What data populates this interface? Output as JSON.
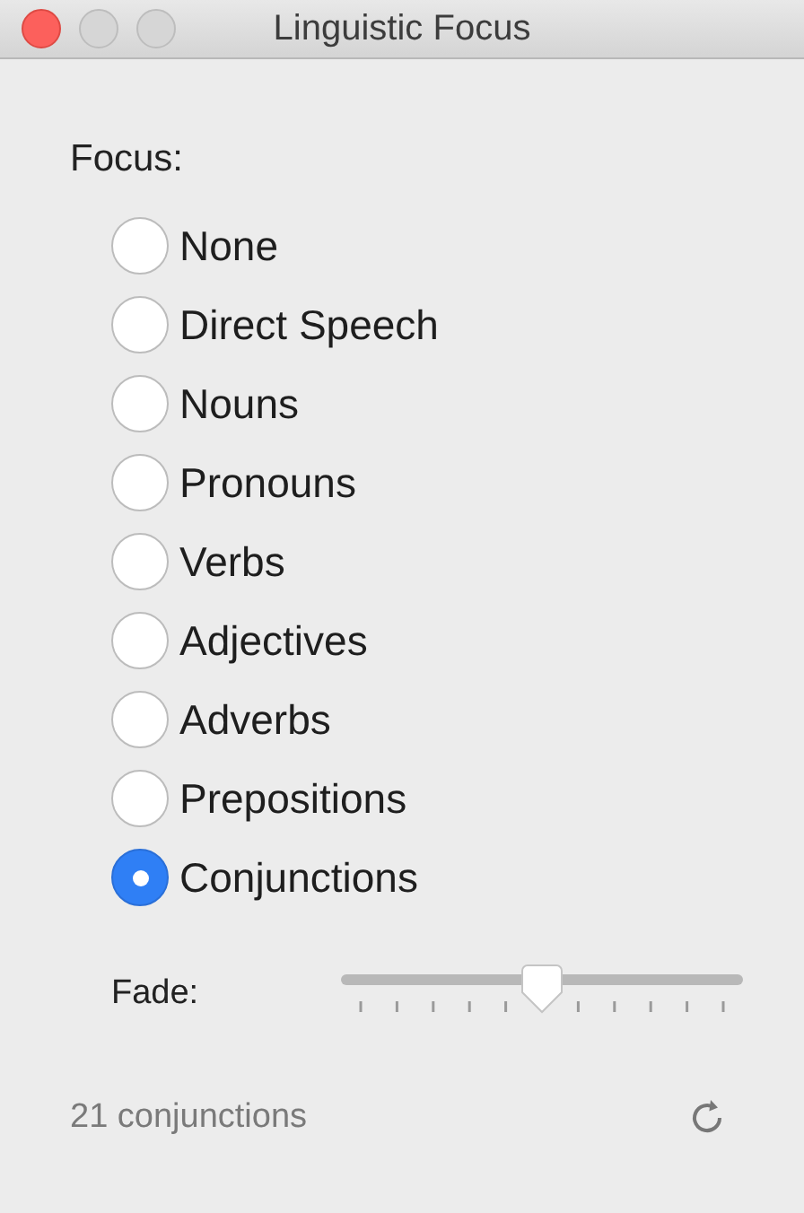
{
  "window": {
    "title": "Linguistic Focus"
  },
  "focus": {
    "label": "Focus:",
    "options": [
      {
        "label": "None",
        "selected": false
      },
      {
        "label": "Direct Speech",
        "selected": false
      },
      {
        "label": "Nouns",
        "selected": false
      },
      {
        "label": "Pronouns",
        "selected": false
      },
      {
        "label": "Verbs",
        "selected": false
      },
      {
        "label": "Adjectives",
        "selected": false
      },
      {
        "label": "Adverbs",
        "selected": false
      },
      {
        "label": "Prepositions",
        "selected": false
      },
      {
        "label": "Conjunctions",
        "selected": true
      }
    ]
  },
  "fade": {
    "label": "Fade:",
    "level": 0.5
  },
  "status": {
    "text": "21 conjunctions"
  }
}
